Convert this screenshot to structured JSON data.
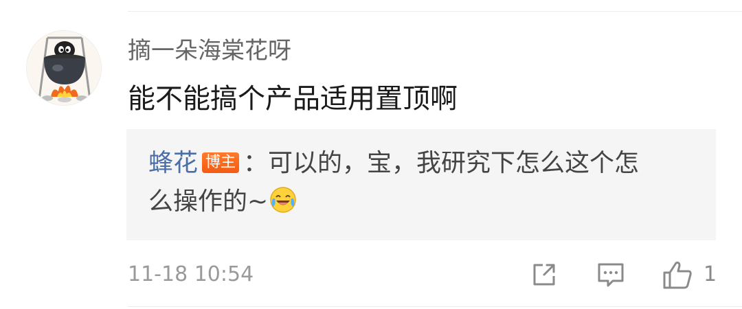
{
  "comment": {
    "username": "摘一朵海棠花呀",
    "text": "能不能搞个产品适用置顶啊",
    "avatar_icon": "penguin-pot-fire-avatar"
  },
  "reply": {
    "author": "蜂花",
    "badge": "博主",
    "line1": "：可以的，宝，我研究下怎么这个怎",
    "line2": "么操作的~",
    "emoji": "laugh-cry-emoji"
  },
  "footer": {
    "timestamp": "11-18 10:54",
    "like_count": "1",
    "icons": [
      "share-icon",
      "comment-icon",
      "like-icon"
    ]
  },
  "colors": {
    "author_blue": "#4a6fa8",
    "badge_orange": "#f45a12",
    "reply_bg": "#f5f5f5"
  }
}
